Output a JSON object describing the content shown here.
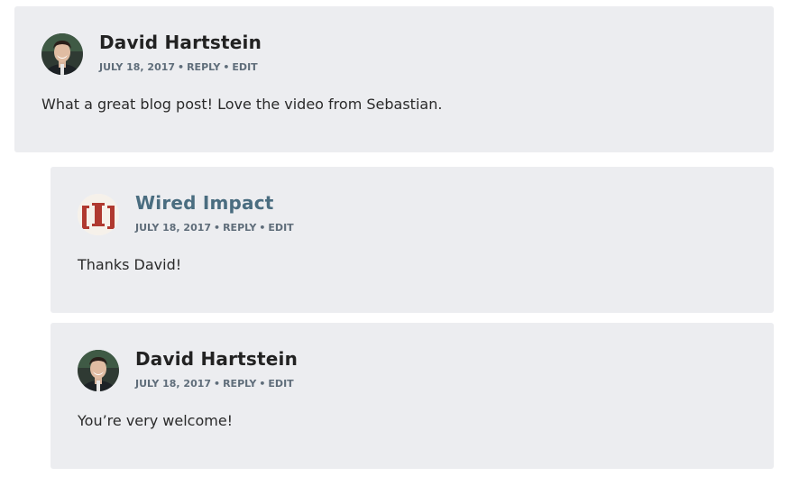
{
  "comments": [
    {
      "author": "David Hartstein",
      "date": "July 18, 2017",
      "reply_label": "Reply",
      "edit_label": "Edit",
      "text": "What a great blog post! Love the video from Sebastian."
    },
    {
      "author": "Wired Impact",
      "date": "July 18, 2017",
      "reply_label": "Reply",
      "edit_label": "Edit",
      "text": "Thanks David!"
    },
    {
      "author": "David Hartstein",
      "date": "July 18, 2017",
      "reply_label": "Reply",
      "edit_label": "Edit",
      "text": "You’re very welcome!"
    }
  ],
  "colors": {
    "card_bg": "#ecedf0",
    "author_link": "#4a6d80",
    "meta": "#5f6d7a",
    "logo_red": "#b0392f"
  },
  "icons": {
    "avatar_david": "avatar-photo",
    "avatar_wired": "wired-impact-logo"
  }
}
